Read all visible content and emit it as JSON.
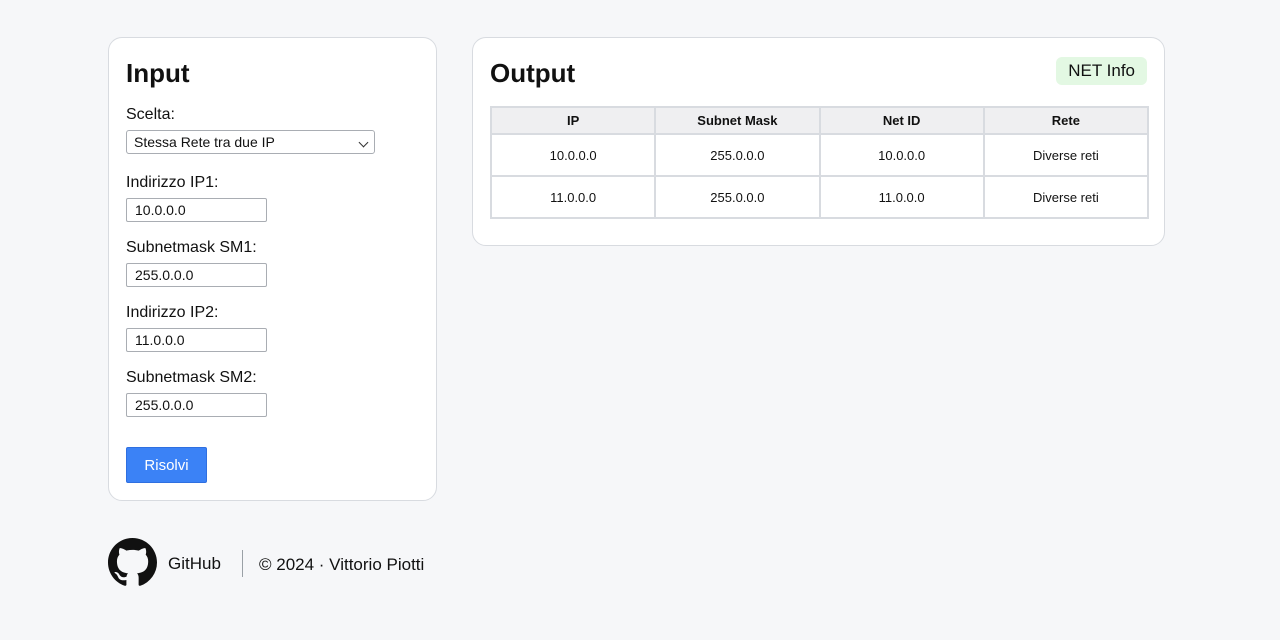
{
  "input": {
    "title": "Input",
    "choice_label": "Scelta:",
    "choice_value": "Stessa Rete tra due IP",
    "ip1_label": "Indirizzo IP1:",
    "ip1_value": "10.0.0.0",
    "sm1_label": "Subnetmask SM1:",
    "sm1_value": "255.0.0.0",
    "ip2_label": "Indirizzo IP2:",
    "ip2_value": "11.0.0.0",
    "sm2_label": "Subnetmask SM2:",
    "sm2_value": "255.0.0.0",
    "submit_label": "Risolvi"
  },
  "output": {
    "title": "Output",
    "badge": "NET Info",
    "columns": [
      "IP",
      "Subnet Mask",
      "Net ID",
      "Rete"
    ],
    "rows": [
      [
        "10.0.0.0",
        "255.0.0.0",
        "10.0.0.0",
        "Diverse reti"
      ],
      [
        "11.0.0.0",
        "255.0.0.0",
        "11.0.0.0",
        "Diverse reti"
      ]
    ]
  },
  "footer": {
    "github_label": "GitHub",
    "copyright": "© 2024 · Vittorio Piotti"
  },
  "colors": {
    "accent": "#3b82f6",
    "badge_bg": "#e3f8e3",
    "page_bg": "#f6f7f9"
  },
  "icons": {
    "github": "github-icon",
    "select_chevron": "chevron-down-icon"
  }
}
